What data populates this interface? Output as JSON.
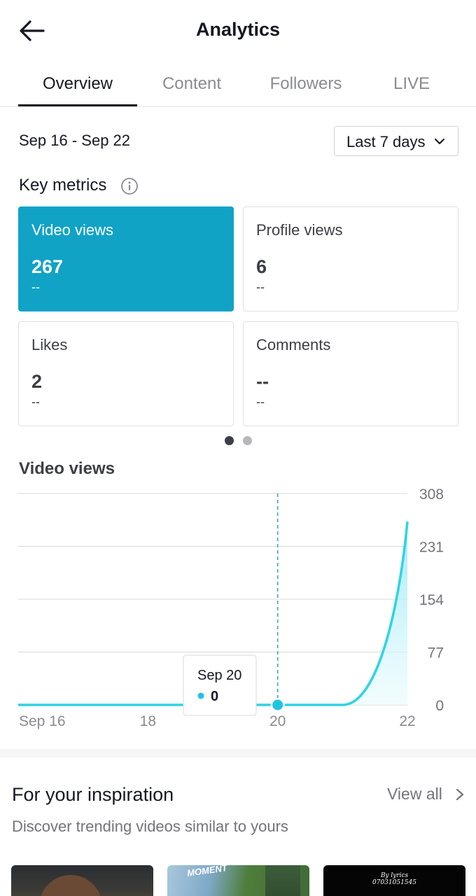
{
  "header": {
    "title": "Analytics",
    "back_icon": "arrow-left-icon"
  },
  "tabs": [
    {
      "label": "Overview",
      "active": true
    },
    {
      "label": "Content",
      "active": false
    },
    {
      "label": "Followers",
      "active": false
    },
    {
      "label": "LIVE",
      "active": false
    }
  ],
  "date_range": "Sep 16 - Sep 22",
  "range_select": {
    "label": "Last 7 days",
    "icon": "chevron-down-icon"
  },
  "key_metrics": {
    "title": "Key metrics",
    "icon": "info-icon",
    "cards": [
      {
        "label": "Video views",
        "value": "267",
        "delta": "--",
        "selected": true
      },
      {
        "label": "Profile views",
        "value": "6",
        "delta": "--",
        "selected": false
      },
      {
        "label": "Likes",
        "value": "2",
        "delta": "--",
        "selected": false
      },
      {
        "label": "Comments",
        "value": "--",
        "delta": "--",
        "selected": false
      }
    ],
    "page_dots": {
      "count": 2,
      "current": 1
    }
  },
  "chart_title": "Video views",
  "chart_data": {
    "type": "area",
    "x": [
      "Sep 16",
      "Sep 17",
      "Sep 18",
      "Sep 19",
      "Sep 20",
      "Sep 21",
      "Sep 22"
    ],
    "x_tick_labels": [
      "Sep 16",
      "18",
      "20",
      "22"
    ],
    "series": [
      {
        "values": [
          0,
          0,
          0,
          0,
          0,
          0,
          267
        ]
      }
    ],
    "y_ticks": [
      "308",
      "231",
      "154",
      "77",
      "0"
    ],
    "ylim": [
      0,
      308
    ],
    "grid": true,
    "y_axis_position": "right",
    "tooltip": {
      "date": "Sep 20",
      "value": "0"
    },
    "colors": {
      "line": "#2dd4e6",
      "fill": "#c6f4fb",
      "marker": "#1ec4e0",
      "guide": "#3aa6bd"
    }
  },
  "inspiration": {
    "title": "For your inspiration",
    "view_all": "View all",
    "view_all_icon": "chevron-right-icon",
    "subtitle": "Discover trending videos similar to yours",
    "thumbs": [
      {
        "text": ""
      },
      {
        "text": "MOMENT"
      },
      {
        "text_line1": "By lyrics",
        "text_line2": "07031051545"
      }
    ]
  },
  "colors": {
    "accent": "#10a3c6",
    "text": "#161823",
    "muted": "#8a8b91"
  }
}
